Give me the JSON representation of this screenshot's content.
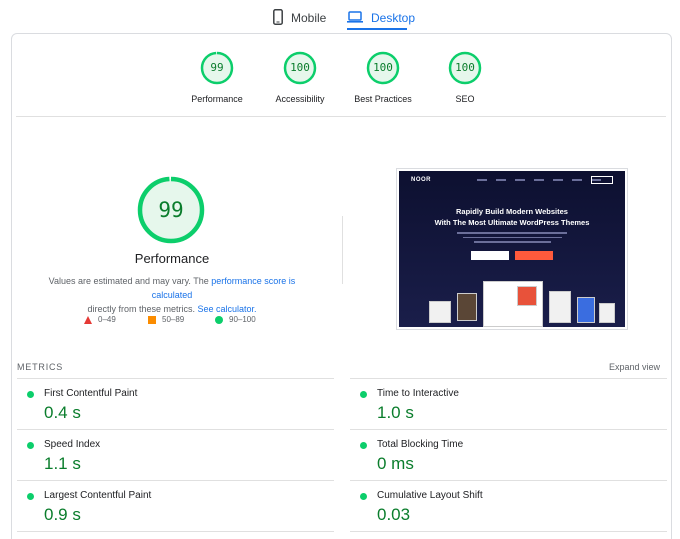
{
  "tabs": {
    "mobile": "Mobile",
    "desktop": "Desktop"
  },
  "categories": [
    {
      "score": "99",
      "label": "Performance",
      "fraction": 0.99
    },
    {
      "score": "100",
      "label": "Accessibility",
      "fraction": 1.0
    },
    {
      "score": "100",
      "label": "Best Practices",
      "fraction": 1.0
    },
    {
      "score": "100",
      "label": "SEO",
      "fraction": 1.0
    }
  ],
  "main_gauge": {
    "score": "99",
    "title": "Performance",
    "fraction": 0.99
  },
  "description": {
    "part1": "Values are estimated and may vary. The ",
    "link1": "performance score is calculated",
    "part2": " directly from these metrics. ",
    "link2": "See calculator."
  },
  "legend": {
    "fail": "0–49",
    "average": "50–89",
    "pass": "90–100"
  },
  "screenshot": {
    "logo": "NOOR",
    "headline_1": "Rapidly Build Modern Websites",
    "headline_2": "With The Most Ultimate WordPress Themes"
  },
  "metrics": {
    "title": "METRICS",
    "expand_label": "Expand view",
    "items": [
      {
        "name": "First Contentful Paint",
        "value": "0.4 s"
      },
      {
        "name": "Time to Interactive",
        "value": "1.0 s"
      },
      {
        "name": "Speed Index",
        "value": "1.1 s"
      },
      {
        "name": "Total Blocking Time",
        "value": "0 ms"
      },
      {
        "name": "Largest Contentful Paint",
        "value": "0.9 s"
      },
      {
        "name": "Cumulative Layout Shift",
        "value": "0.03"
      }
    ]
  },
  "colors": {
    "pass": "#0cce6b",
    "pass_text": "#0a7d2c",
    "pass_bg": "#e6f7ec",
    "average": "#fb8c00",
    "fail": "#e53935",
    "accent": "#1a73e8"
  }
}
